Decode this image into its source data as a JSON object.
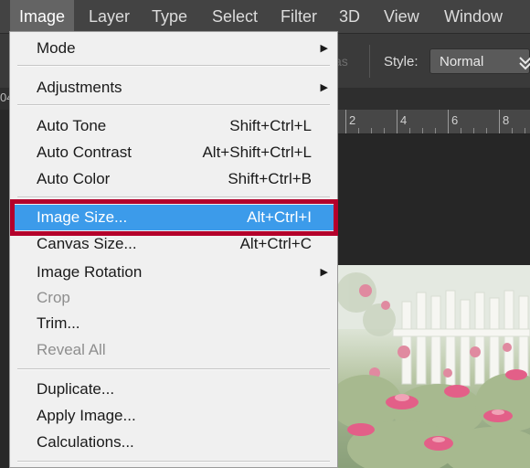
{
  "menubar": {
    "items": [
      {
        "label": "Image",
        "active": true
      },
      {
        "label": "Layer"
      },
      {
        "label": "Type"
      },
      {
        "label": "Select"
      },
      {
        "label": "Filter"
      },
      {
        "label": "3D"
      },
      {
        "label": "View"
      },
      {
        "label": "Window"
      }
    ]
  },
  "options_bar": {
    "faded_text": "as",
    "style_label": "Style:",
    "style_value": "Normal"
  },
  "tab": {
    "fragment": "04"
  },
  "ruler": {
    "labels": [
      "2",
      "4",
      "6",
      "8"
    ]
  },
  "image_menu": {
    "groups": [
      [
        {
          "label": "Mode",
          "submenu": true
        }
      ],
      [
        {
          "label": "Adjustments",
          "submenu": true
        }
      ],
      [
        {
          "label": "Auto Tone",
          "shortcut": "Shift+Ctrl+L"
        },
        {
          "label": "Auto Contrast",
          "shortcut": "Alt+Shift+Ctrl+L"
        },
        {
          "label": "Auto Color",
          "shortcut": "Shift+Ctrl+B"
        }
      ],
      [
        {
          "label": "Image Size...",
          "shortcut": "Alt+Ctrl+I",
          "highlighted": true
        },
        {
          "label": "Canvas Size...",
          "shortcut": "Alt+Ctrl+C"
        },
        {
          "label": "Image Rotation",
          "submenu": true
        },
        {
          "label": "Crop",
          "disabled": true
        },
        {
          "label": "Trim..."
        },
        {
          "label": "Reveal All",
          "disabled": true
        }
      ],
      [
        {
          "label": "Duplicate..."
        },
        {
          "label": "Apply Image..."
        },
        {
          "label": "Calculations..."
        }
      ]
    ]
  },
  "colors": {
    "menu_highlight": "#3c9bea",
    "annotation_box": "#b4002b",
    "menubar_bg": "#434343"
  },
  "icons": {
    "submenu": "submenu-arrow-icon",
    "dropdown": "chevron-down-icon"
  }
}
